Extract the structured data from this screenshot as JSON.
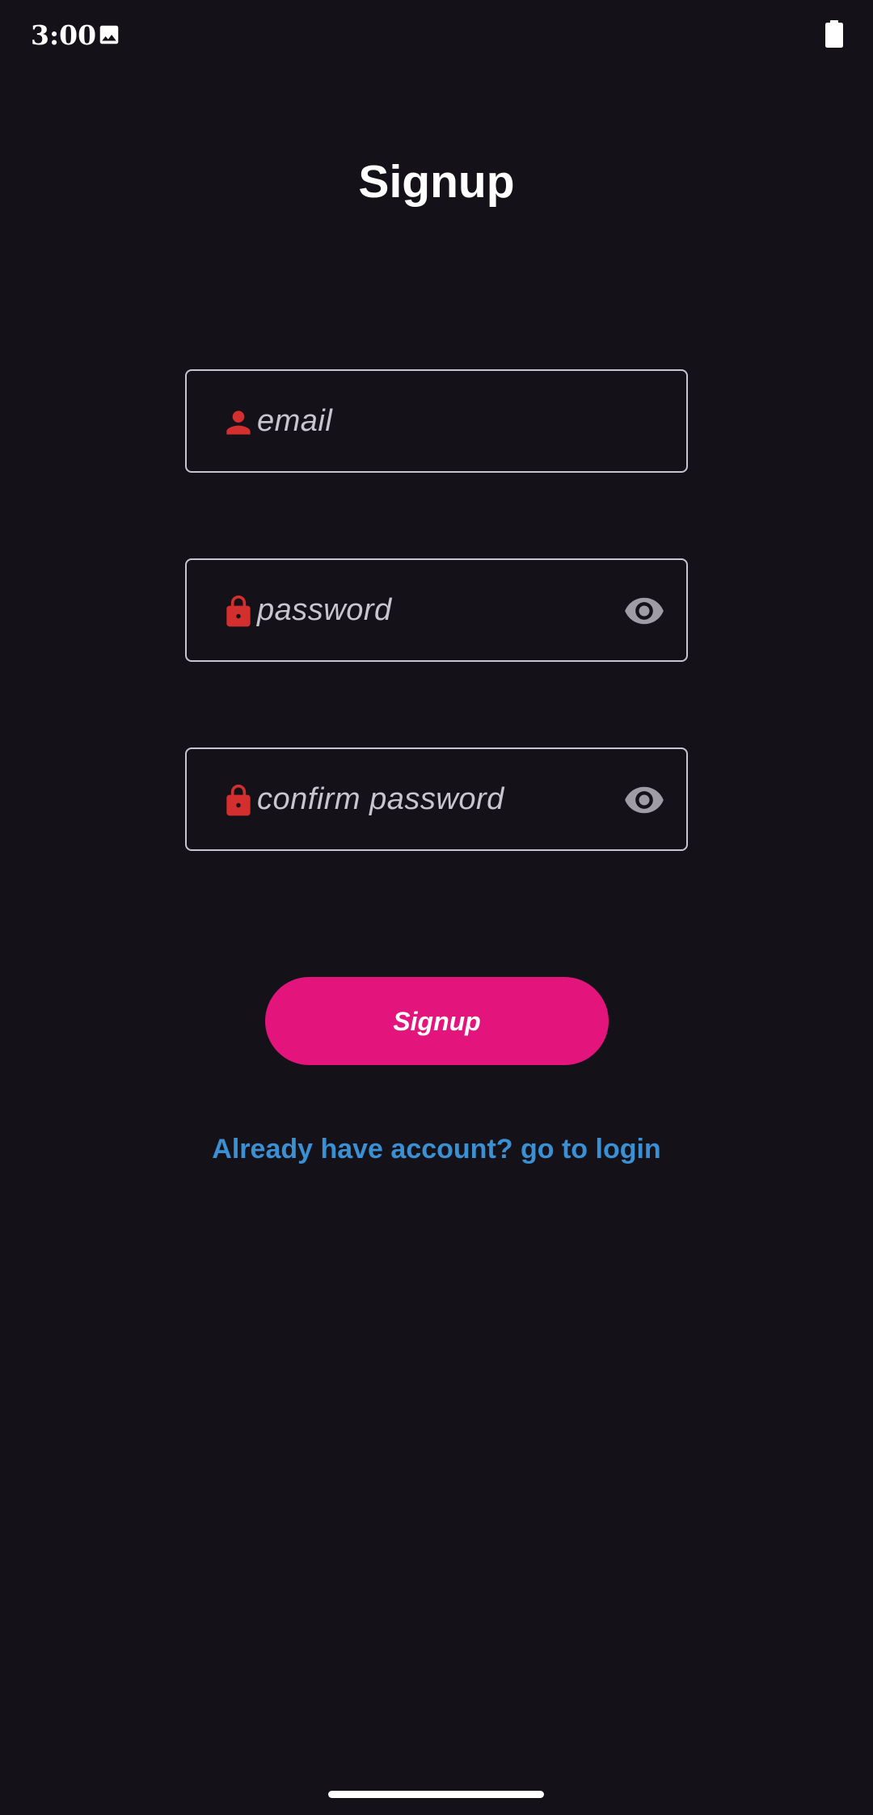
{
  "status_bar": {
    "time": "3:00",
    "icons": [
      "image-icon",
      "battery-icon"
    ]
  },
  "page": {
    "title": "Signup"
  },
  "form": {
    "email": {
      "placeholder": "email",
      "icon": "person-icon",
      "value": ""
    },
    "password": {
      "placeholder": "password",
      "icon": "lock-icon",
      "toggle_icon": "eye-icon",
      "value": ""
    },
    "confirm_password": {
      "placeholder": "confirm password",
      "icon": "lock-icon",
      "toggle_icon": "eye-icon",
      "value": ""
    },
    "submit_label": "Signup",
    "login_link": "Already have account? go to login"
  },
  "colors": {
    "background": "#141218",
    "field_border": "#c9c5cf",
    "icon_red": "#d32f2f",
    "button": "#e3157d",
    "link": "#3b8fd3"
  }
}
